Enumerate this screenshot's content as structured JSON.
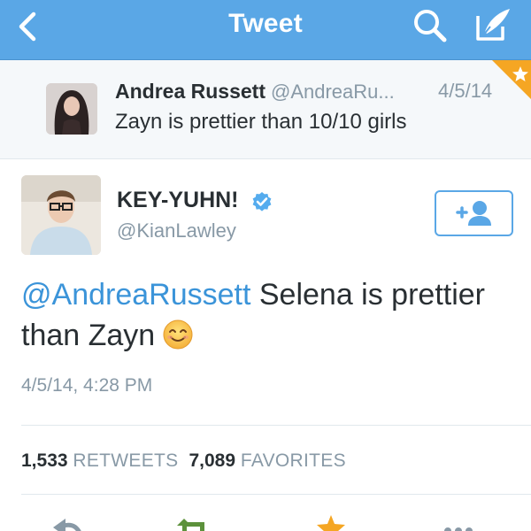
{
  "nav": {
    "title": "Tweet",
    "back_icon": "chevron-left-icon",
    "search_icon": "search-icon",
    "compose_icon": "compose-icon",
    "bar_color": "#5aa7e6"
  },
  "parent_tweet": {
    "name": "Andrea Russett",
    "handle": "@AndreaRu...",
    "date": "4/5/14",
    "text": "Zayn is prettier than 10/10 girls",
    "favorited": true
  },
  "tweet": {
    "name": "KEY-YUHN!",
    "verified": true,
    "handle": "@KianLawley",
    "mention": "@AndreaRussett",
    "text": " Selena is prettier than Zayn",
    "emoji": "smiling-face-icon",
    "timestamp": "4/5/14, 4:28 PM",
    "mention_color": "#3b94d9"
  },
  "stats": {
    "retweets_count": "1,533",
    "retweets_label": "RETWEETS",
    "favorites_count": "7,089",
    "favorites_label": "FAVORITES"
  },
  "actions": [
    "reply-icon",
    "retweet-icon",
    "favorite-icon",
    "more-icon"
  ]
}
